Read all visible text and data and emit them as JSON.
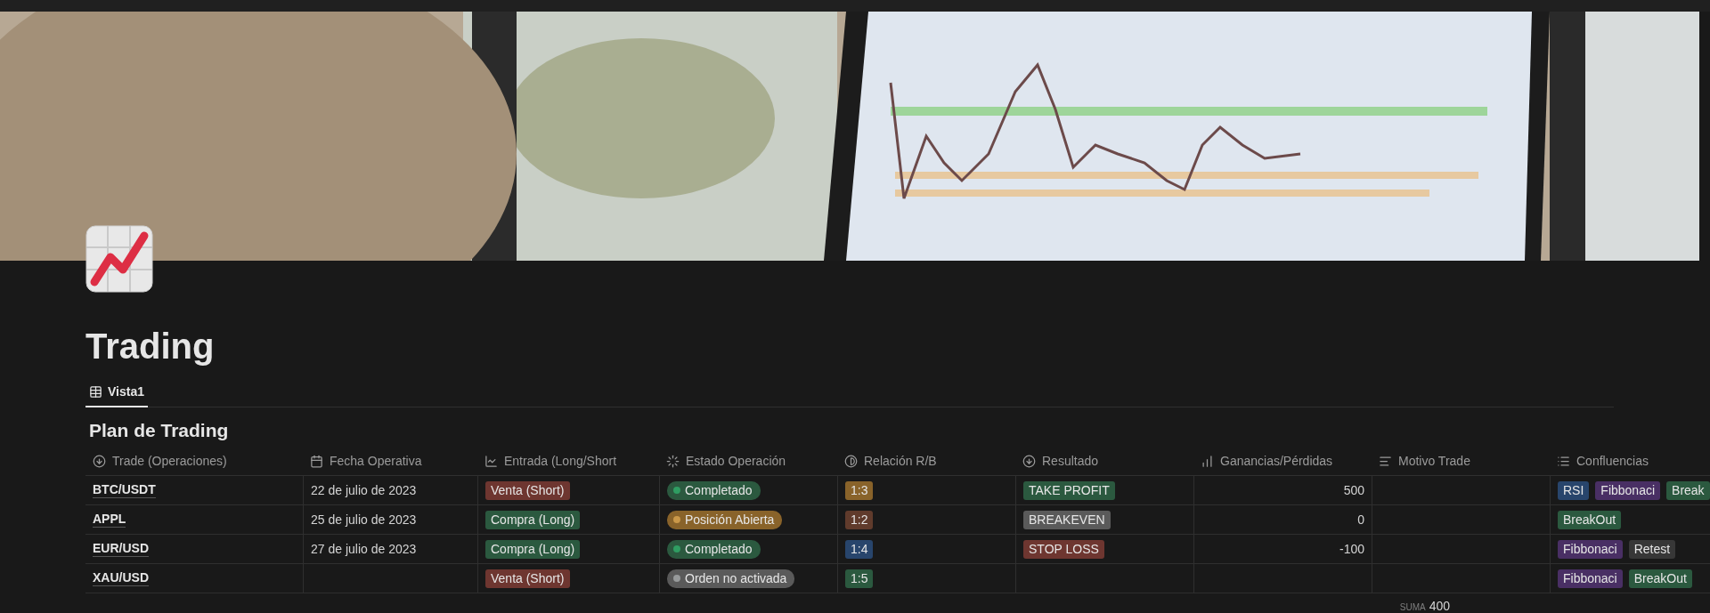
{
  "page": {
    "title": "Trading"
  },
  "tabs": [
    {
      "label": "Vista1",
      "selected": true
    }
  ],
  "table": {
    "title": "Plan de Trading",
    "columns": [
      "Trade (Operaciones)",
      "Fecha Operativa",
      "Entrada (Long/Short",
      "Estado Operación",
      "Relación R/B",
      "Resultado",
      "Ganancias/Pérdidas",
      "Motivo Trade",
      "Confluencias"
    ],
    "rows": [
      {
        "trade": "BTC/USDT",
        "fecha": "22 de julio de 2023",
        "entrada": {
          "label": "Venta (Short)",
          "color": "#6e3630"
        },
        "estado": {
          "label": "Completado",
          "color": "#2f9d62"
        },
        "relacion": {
          "label": "1:3",
          "color": "#89632a"
        },
        "resultado": {
          "label": "TAKE PROFIT",
          "color": "#2b593f"
        },
        "ganancias": "500",
        "confluencias": [
          {
            "label": "RSI",
            "color": "#28456c"
          },
          {
            "label": "Fibbonaci",
            "color": "#492f64"
          },
          {
            "label": "Break",
            "color": "#2b593f"
          }
        ]
      },
      {
        "trade": "APPL",
        "fecha": "25 de julio de 2023",
        "entrada": {
          "label": "Compra (Long)",
          "color": "#2b593f"
        },
        "estado": {
          "label": "Posición Abierta",
          "color": "#ca9849"
        },
        "relacion": {
          "label": "1:2",
          "color": "#603b2c"
        },
        "resultado": {
          "label": "BREAKEVEN",
          "color": "#5a5a5a"
        },
        "ganancias": "0",
        "confluencias": [
          {
            "label": "BreakOut",
            "color": "#2b593f"
          }
        ]
      },
      {
        "trade": "EUR/USD",
        "fecha": "27 de julio de 2023",
        "entrada": {
          "label": "Compra (Long)",
          "color": "#2b593f"
        },
        "estado": {
          "label": "Completado",
          "color": "#2f9d62"
        },
        "relacion": {
          "label": "1:4",
          "color": "#28456c"
        },
        "resultado": {
          "label": "STOP LOSS",
          "color": "#6e3630"
        },
        "ganancias": "-100",
        "confluencias": [
          {
            "label": "Fibbonaci",
            "color": "#492f64"
          },
          {
            "label": "Retest",
            "color": "#373737"
          }
        ]
      },
      {
        "trade": "XAU/USD",
        "entrada": {
          "label": "Venta (Short)",
          "color": "#6e3630"
        },
        "estado": {
          "label": "Orden no activada",
          "color": "#979a9b"
        },
        "relacion": {
          "label": "1:5",
          "color": "#2b593f"
        },
        "confluencias": [
          {
            "label": "Fibbonaci",
            "color": "#492f64"
          },
          {
            "label": "BreakOut",
            "color": "#2b593f"
          }
        ]
      }
    ],
    "footer": {
      "label": "SUMA",
      "value": "400"
    }
  }
}
